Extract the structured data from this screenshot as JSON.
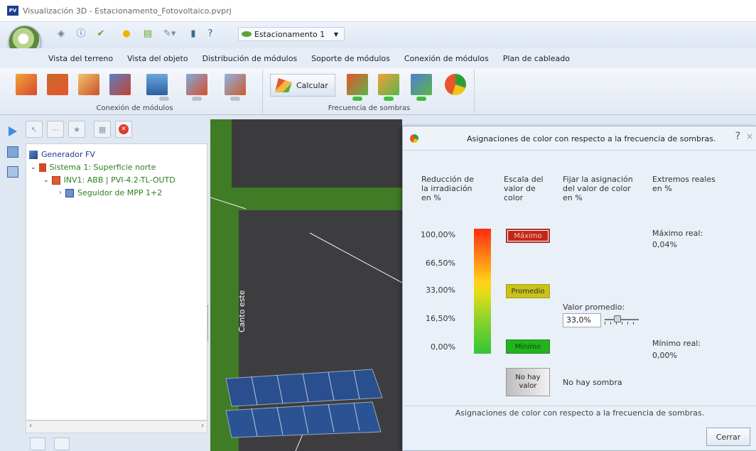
{
  "window": {
    "title": "Visualización 3D - Estacionamento_Fotovoltaico.pvprj",
    "logo_text": "PV"
  },
  "quick_access": {
    "project_selector": "Estacionamento 1",
    "icons": [
      "back-icon",
      "info-icon",
      "check-icon",
      "sun-icon",
      "layers-icon",
      "wrench-icon",
      "export-icon",
      "help-icon"
    ]
  },
  "menu": {
    "items": [
      "Vista del terreno",
      "Vista del objeto",
      "Distribución de módulos",
      "Soporte de módulos",
      "Conexión de módulos",
      "Plan de cableado"
    ]
  },
  "ribbon": {
    "group_connection_label": "Conexión de módulos",
    "group_shading_label": "Frecuencia de sombras",
    "calculate_label": "Calcular"
  },
  "tree": {
    "items": [
      {
        "label": "Generador FV",
        "color": "#1a3a8a"
      },
      {
        "label": "Sistema 1:  Superficie norte",
        "color": "#2e7d1f"
      },
      {
        "label": "INV1: ABB | PVI-4.2-TL-OUTD",
        "color": "#2e7d1f"
      },
      {
        "label": "Seguidor de MPP 1+2",
        "color": "#2e7d1f"
      }
    ]
  },
  "scene": {
    "edge_label": "Canto este"
  },
  "dialog": {
    "title": "Asignaciones de color con respecto a la frecuencia de sombras.",
    "help": "?",
    "close_x": "×",
    "columns": {
      "reduction": "Reducción de la irradiación en %",
      "scale": "Escala del valor de color",
      "fix": "Fijar la asignación del valor de color en %",
      "extremes": "Extremos reales en %"
    },
    "ticks": [
      "100,00%",
      "66,50%",
      "33,00%",
      "16,50%",
      "0,00%"
    ],
    "swatches": {
      "max": "Máximo",
      "avg": "Promedio",
      "min": "Mínimo",
      "none": "No hay valor"
    },
    "avg_label": "Valor promedio:",
    "avg_value": "33,0%",
    "avg_fraction": 0.33,
    "max_real_label": "Máximo real:",
    "max_real_value": "0,04%",
    "min_real_label": "Mínimo real:",
    "min_real_value": "0,00%",
    "no_shade": "No hay sombra",
    "footer": "Asignaciones de color con respecto a la frecuencia de sombras.",
    "close_button": "Cerrar"
  }
}
